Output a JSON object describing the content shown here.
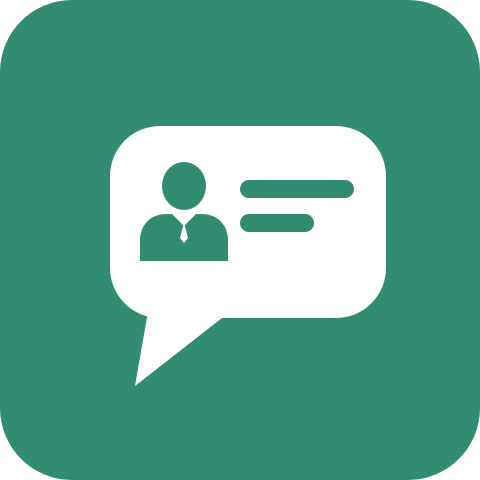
{
  "icon": {
    "name": "chat-profile-app-icon",
    "colors": {
      "background": "#318C72",
      "bubble": "#FFFFFF",
      "glyph": "#318C72"
    }
  }
}
